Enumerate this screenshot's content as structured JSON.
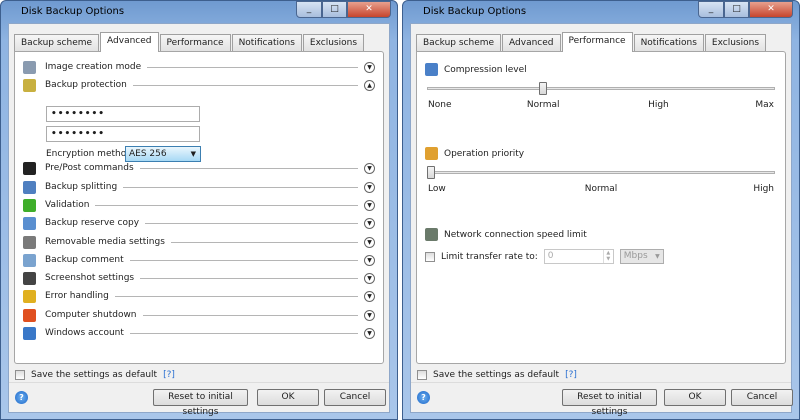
{
  "window_title": "Disk Backup Options",
  "tabs": [
    "Backup scheme",
    "Advanced",
    "Performance",
    "Notifications",
    "Exclusions"
  ],
  "left": {
    "active_tab": "Advanced",
    "items": [
      {
        "label": "Image creation mode",
        "icon": "disk-image-icon",
        "color": "#8a9bb0",
        "expanded": false
      },
      {
        "label": "Backup protection",
        "icon": "lock-icon",
        "color": "#c8b040",
        "expanded": true
      },
      {
        "label": "Pre/Post commands",
        "icon": "terminal-icon",
        "color": "#222222",
        "expanded": false
      },
      {
        "label": "Backup splitting",
        "icon": "split-icon",
        "color": "#4f7fc0",
        "expanded": false
      },
      {
        "label": "Validation",
        "icon": "checkmark-icon",
        "color": "#3fae2a",
        "expanded": false
      },
      {
        "label": "Backup reserve copy",
        "icon": "copy-icon",
        "color": "#5a8fd0",
        "expanded": false
      },
      {
        "label": "Removable media settings",
        "icon": "usb-drive-icon",
        "color": "#7a7a7a",
        "expanded": false
      },
      {
        "label": "Backup comment",
        "icon": "comment-icon",
        "color": "#7aa3cf",
        "expanded": false
      },
      {
        "label": "Screenshot settings",
        "icon": "camera-icon",
        "color": "#444444",
        "expanded": false
      },
      {
        "label": "Error handling",
        "icon": "warning-icon",
        "color": "#e0b020",
        "expanded": false
      },
      {
        "label": "Computer shutdown",
        "icon": "power-icon",
        "color": "#e05020",
        "expanded": false
      },
      {
        "label": "Windows account",
        "icon": "shield-icon",
        "color": "#3a78c8",
        "expanded": false
      }
    ],
    "password": "••••••••",
    "password_confirm": "••••••••",
    "encryption_label": "Encryption method:",
    "encryption_value": "AES 256"
  },
  "right": {
    "active_tab": "Performance",
    "compression": {
      "label": "Compression level",
      "ticks": [
        "None",
        "Normal",
        "High",
        "Max"
      ],
      "value": "Normal"
    },
    "priority": {
      "label": "Operation priority",
      "ticks": [
        "Low",
        "Normal",
        "High"
      ],
      "value": "Low"
    },
    "network": {
      "label": "Network connection speed limit",
      "limit_label": "Limit transfer rate to:",
      "limit_checked": false,
      "rate_value": "0",
      "unit": "Mbps"
    }
  },
  "footer": {
    "save_default": "Save the settings as default",
    "help_link": "[?]",
    "reset": "Reset to initial settings",
    "ok": "OK",
    "cancel": "Cancel"
  }
}
